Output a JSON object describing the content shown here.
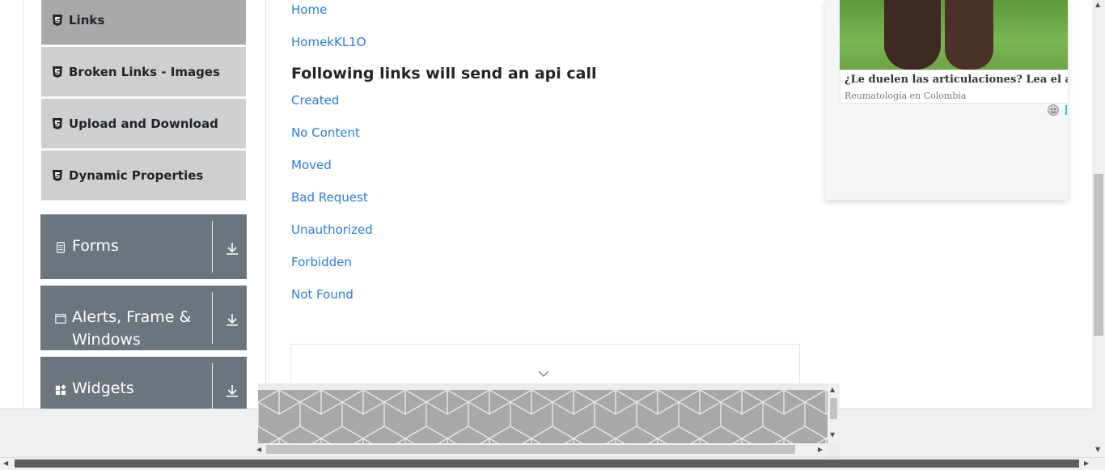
{
  "sidebar": {
    "sub_items": [
      {
        "label": "Links",
        "active": true
      },
      {
        "label": "Broken Links - Images",
        "active": false
      },
      {
        "label": "Upload and Download",
        "active": false
      },
      {
        "label": "Dynamic Properties",
        "active": false
      }
    ],
    "groups": [
      {
        "label": "Forms",
        "icon": "form-icon"
      },
      {
        "label": "Alerts, Frame & Windows",
        "icon": "window-icon"
      },
      {
        "label": "Widgets",
        "icon": "widgets-icon"
      }
    ]
  },
  "main": {
    "links_top": [
      "Home",
      "HomekKL1O"
    ],
    "api_heading": "Following links will send an api call",
    "api_links": [
      "Created",
      "No Content",
      "Moved",
      "Bad Request",
      "Unauthorized",
      "Forbidden",
      "Not Found"
    ]
  },
  "right_ad": {
    "title": "¿Le duelen las articulaciones? Lea el artículo",
    "source": "Reumatología en Colombia"
  },
  "colors": {
    "link": "#2a7ae2",
    "group_bg": "#6c757d",
    "sub_item_bg": "#cfcfcf",
    "sub_item_active_bg": "#a9a9a9"
  }
}
